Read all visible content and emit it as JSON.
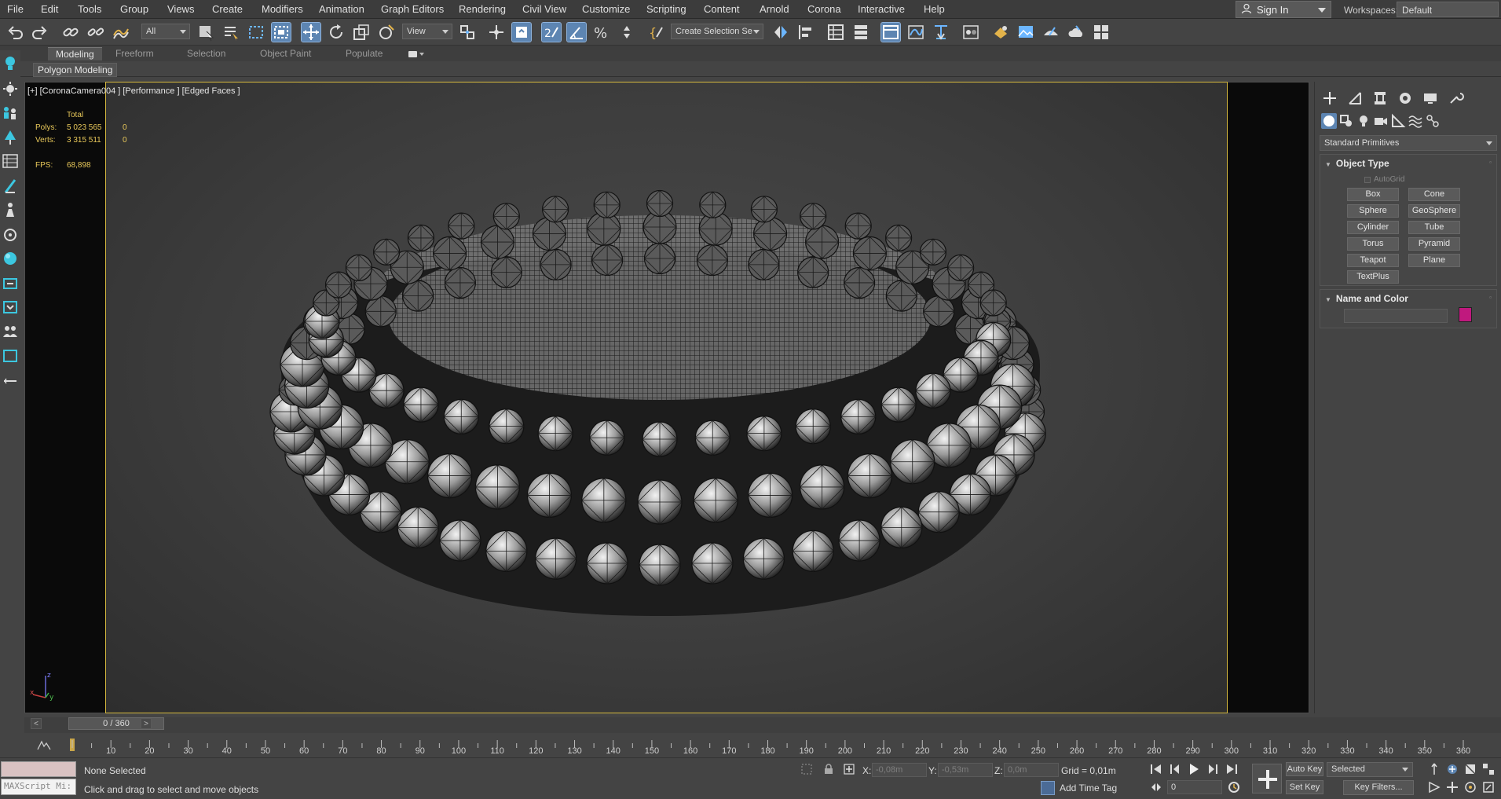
{
  "menu": [
    "File",
    "Edit",
    "Tools",
    "Group",
    "Views",
    "Create",
    "Modifiers",
    "Animation",
    "Graph Editors",
    "Rendering",
    "Civil View",
    "Customize",
    "Scripting",
    "Content",
    "Arnold",
    "Corona",
    "Interactive",
    "Help"
  ],
  "account": {
    "sign_in": "Sign In",
    "workspaces_label": "Workspaces:",
    "workspace": "Default"
  },
  "toolbar": {
    "filter": "All",
    "ref_coord": "View",
    "named_selection": "Create Selection Se"
  },
  "ribbon": {
    "tabs": [
      "Modeling",
      "Freeform",
      "Selection",
      "Object Paint",
      "Populate"
    ],
    "panel_label": "Polygon Modeling"
  },
  "viewport": {
    "label": "[+] [CoronaCamera004 ] [Performance ] [Edged Faces ]",
    "stats": {
      "total_header": "Total",
      "polys_label": "Polys:",
      "polys_total": "5 023 565",
      "polys_sel": "0",
      "verts_label": "Verts:",
      "verts_total": "3 315 511",
      "verts_sel": "0",
      "fps_label": "FPS:",
      "fps": "68,898"
    },
    "axis_labels": {
      "x": "x",
      "y": "y",
      "z": "z"
    }
  },
  "command_panel": {
    "category": "Standard Primitives",
    "object_type_title": "Object Type",
    "autogrid": "AutoGrid",
    "primitives": [
      "Box",
      "Cone",
      "Sphere",
      "GeoSphere",
      "Cylinder",
      "Tube",
      "Torus",
      "Pyramid",
      "Teapot",
      "Plane",
      "TextPlus"
    ],
    "name_color_title": "Name and Color",
    "object_color": "#c0197e"
  },
  "timeline": {
    "frame_display": "0 / 360",
    "ticks": [
      "10",
      "20",
      "30",
      "40",
      "50",
      "60",
      "70",
      "80",
      "90",
      "100",
      "110",
      "120",
      "130",
      "140",
      "150",
      "160",
      "170",
      "180",
      "190",
      "200",
      "210",
      "220",
      "230",
      "240",
      "250",
      "260",
      "270",
      "280",
      "290",
      "300",
      "310",
      "320",
      "330",
      "340",
      "350",
      "360"
    ]
  },
  "status": {
    "maxscript_placeholder": "MAXScript Mi:",
    "selection": "None Selected",
    "prompt": "Click and drag to select and move objects",
    "x_label": "X:",
    "x_value": "-0,08m",
    "y_label": "Y:",
    "y_value": "-0,53m",
    "z_label": "Z:",
    "z_value": "0,0m",
    "grid": "Grid = 0,01m",
    "add_time_tag": "Add Time Tag",
    "current_frame": "0",
    "auto_key": "Auto Key",
    "set_key": "Set Key",
    "key_mode": "Selected",
    "key_filters": "Key Filters..."
  }
}
